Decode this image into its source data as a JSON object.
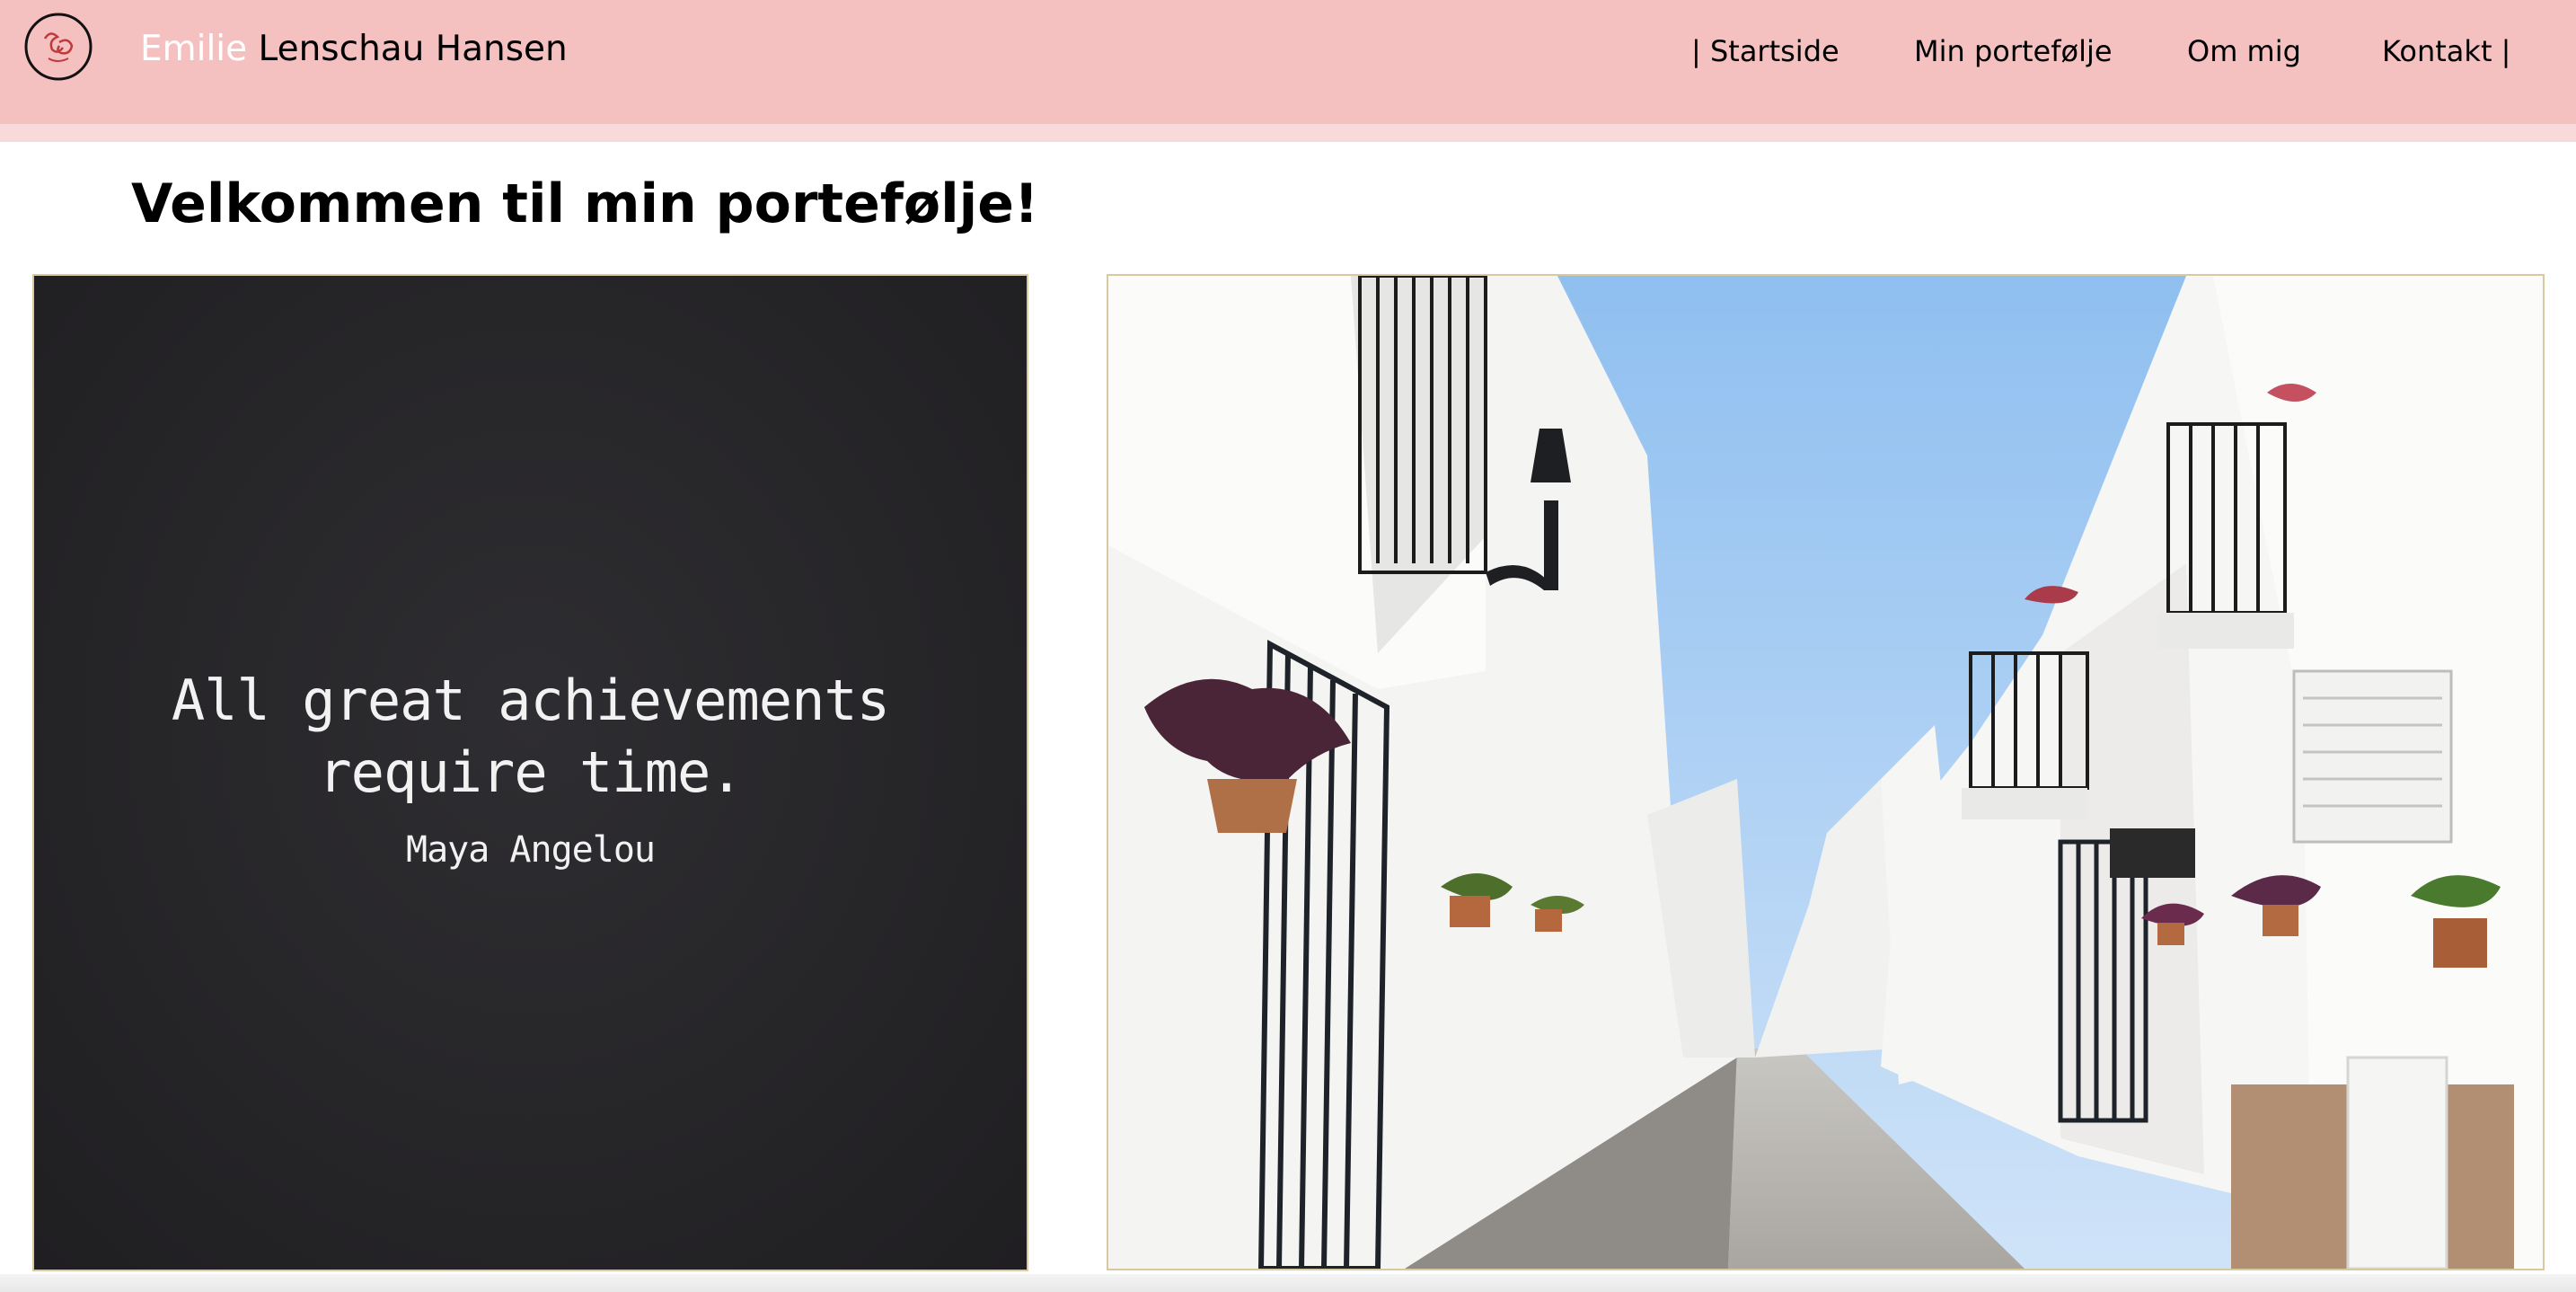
{
  "header": {
    "brand_first": "Emilie",
    "brand_rest": "Lenschau Hansen",
    "logo_icon": "circle-monogram-logo-icon",
    "nav": {
      "startside": "| Startside",
      "portfolio": "Min portefølje",
      "om": "Om mig",
      "kontakt": "Kontakt |"
    },
    "colors": {
      "background": "#f5c0c0",
      "brand_first": "#ffffff"
    }
  },
  "main": {
    "title": "Velkommen til min portefølje!",
    "quote": {
      "line1": "All great achievements",
      "line2": "require time.",
      "author": "Maya Angelou"
    }
  }
}
